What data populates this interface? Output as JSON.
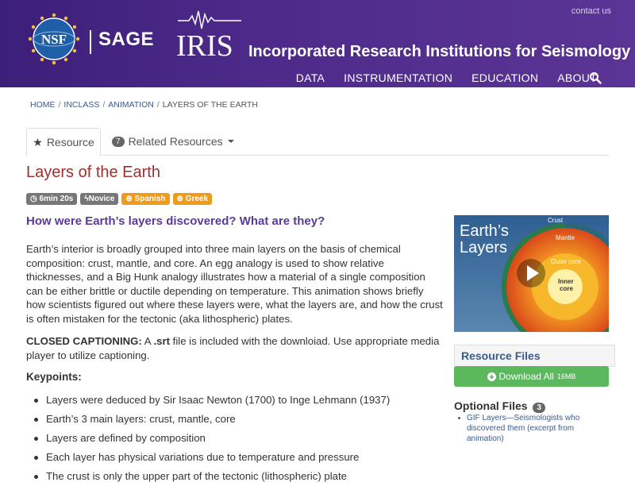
{
  "header": {
    "contact_label": "contact us",
    "sage_label": "SAGE",
    "nsf_label": "NSF",
    "iris_label": "IRIS",
    "org_name": "Incorporated Research Institutions for Seismology",
    "nav": [
      "DATA",
      "INSTRUMENTATION",
      "EDUCATION",
      "ABOUT"
    ],
    "bg_color": "#4a2a88"
  },
  "breadcrumb": [
    "HOME",
    "INCLASS",
    "ANIMATION",
    "LAYERS OF THE EARTH"
  ],
  "tabs": {
    "resource_label": "Resource",
    "related_label": "Related Resources",
    "related_count": "7"
  },
  "page_title": "Layers of the Earth",
  "tags": [
    "6min 20s",
    "Novice",
    "Spanish",
    "Greek"
  ],
  "question": "How were Earth’s layers discovered? What are they?",
  "paragraph1": "Earth’s interior is broadly grouped into three main layers on the basis of chemical composition: crust, mantle, and core. An egg analogy is used to show relative thicknesses, and a Big Hunk analogy illustrates how a material of a single composition can be either brittle or ductile depending on temperature. This animation shows briefly how scientists figured out where these layers were, what the layers are, and how the crust is often mistaken for the tectonic (aka lithospheric) plates.",
  "captioning": {
    "label": "CLOSED CAPTIONING:",
    "text_before": " A ",
    "srt": ".srt",
    "text_after": " file is included with the downloiad. Use appropriate media player to utilize captioning."
  },
  "keypoints_title": "Keypoints:",
  "keypoints": [
    "Layers were deduced by Sir Isaac Newton (1700) to Inge Lehmann (1937)",
    "Earth’s 3 main layers: crust, mantle, core",
    "Layers are defined by composition",
    "Each layer has physical variations due to temperature and pressure",
    "The crust is only the upper part of the tectonic (lithospheric) plate"
  ],
  "video": {
    "title_line1": "Earth’s",
    "title_line2": "Layers",
    "crust": "Crust",
    "mantle": "Mantle",
    "outer_core": "Outer core",
    "inner_core_1": "Inner",
    "inner_core_2": "core"
  },
  "resource_files_title": "Resource Files",
  "download": {
    "label": "Download All",
    "size": "16MB",
    "color": "#5cb85c"
  },
  "optional_files": {
    "title": "Optional Files",
    "count": "3",
    "items": [
      "GIF Layers—Seismologists who discovered them (excerpt from animation)"
    ]
  }
}
